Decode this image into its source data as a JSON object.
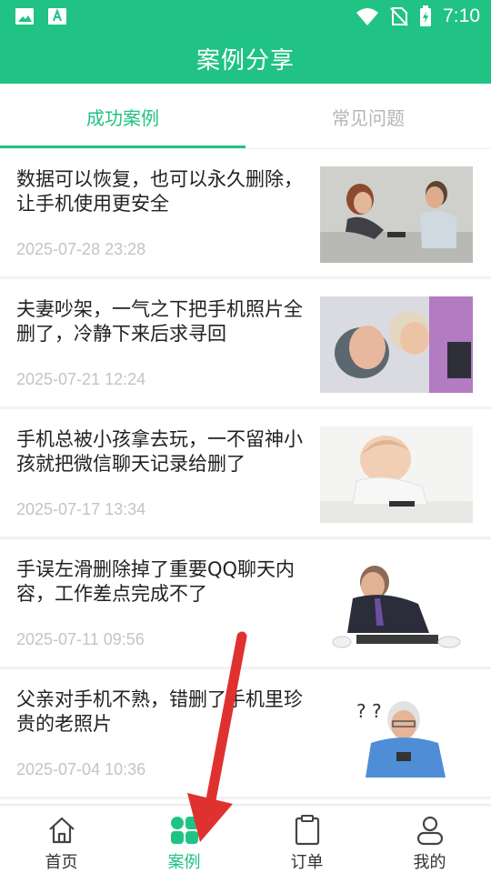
{
  "status_bar": {
    "time": "7:10",
    "icons": [
      "image-icon",
      "font-icon",
      "wifi-icon",
      "no-sim-icon",
      "battery-charging-icon"
    ]
  },
  "header": {
    "title": "案例分享"
  },
  "tabs": [
    {
      "label": "成功案例",
      "active": true
    },
    {
      "label": "常见问题",
      "active": false
    }
  ],
  "cases": [
    {
      "title": "数据可以恢复，也可以永久删除，让手机使用更安全",
      "date": "2025-07-28 23:28",
      "image": "couple-phone-photo"
    },
    {
      "title": "夫妻吵架，一气之下把手机照片全删了，冷静下来后求寻回",
      "date": "2025-07-21 12:24",
      "image": "couple-lying-photo"
    },
    {
      "title": "手机总被小孩拿去玩，一不留神小孩就把微信聊天记录给删了",
      "date": "2025-07-17 13:34",
      "image": "baby-phone-photo"
    },
    {
      "title": "手误左滑删除掉了重要QQ聊天内容，工作差点完成不了",
      "date": "2025-07-11 09:56",
      "image": "stressed-worker-photo"
    },
    {
      "title": "父亲对手机不熟，错删了手机里珍贵的老照片",
      "date": "2025-07-04 10:36",
      "image": "old-man-phone-photo"
    }
  ],
  "bottom_nav": [
    {
      "label": "首页",
      "icon": "home-icon",
      "active": false
    },
    {
      "label": "案例",
      "icon": "cases-grid-icon",
      "active": true
    },
    {
      "label": "订单",
      "icon": "clipboard-icon",
      "active": false
    },
    {
      "label": "我的",
      "icon": "user-icon",
      "active": false
    }
  ],
  "colors": {
    "brand": "#20c383",
    "annotation_arrow": "#e03131"
  }
}
